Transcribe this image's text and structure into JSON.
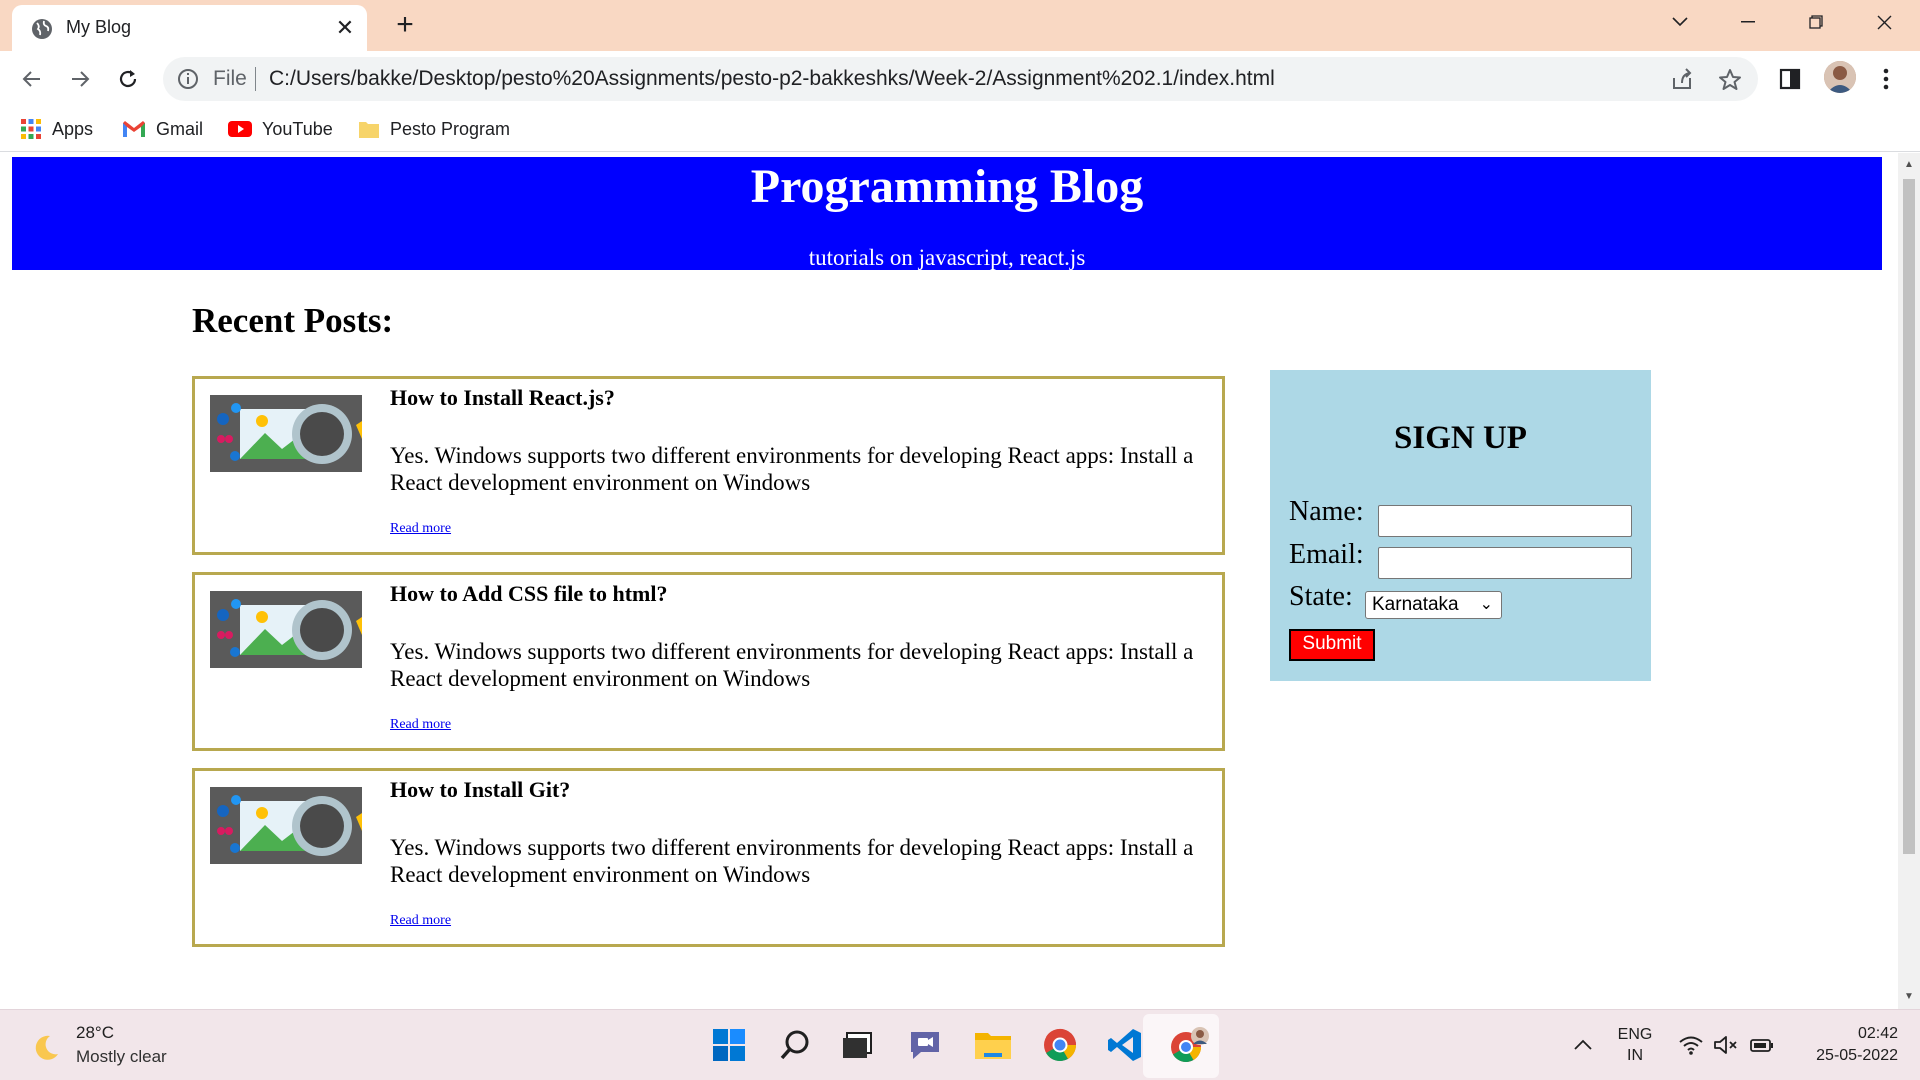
{
  "browser": {
    "tab_title": "My Blog",
    "omnibox_scheme": "File",
    "url": "C:/Users/bakke/Desktop/pesto%20Assignments/pesto-p2-bakkeshks/Week-2/Assignment%202.1/index.html",
    "bookmarks": [
      {
        "label": "Apps",
        "icon": "apps-grid-icon"
      },
      {
        "label": "Gmail",
        "icon": "gmail-icon"
      },
      {
        "label": "YouTube",
        "icon": "youtube-icon"
      },
      {
        "label": "Pesto Program",
        "icon": "folder-icon"
      }
    ]
  },
  "page": {
    "header_title": "Programming Blog",
    "header_subtitle": "tutorials on javascript, react.js",
    "section_title": "Recent Posts:",
    "posts": [
      {
        "title": "How to Install React.js?",
        "body": "Yes. Windows supports two different environments for developing React apps: Install a React development environment on Windows",
        "link": "Read more"
      },
      {
        "title": "How to Add CSS file to html?",
        "body": "Yes. Windows supports two different environments for developing React apps: Install a React development environment on Windows",
        "link": "Read more"
      },
      {
        "title": "How to Install Git?",
        "body": "Yes. Windows supports two different environments for developing React apps: Install a React development environment on Windows",
        "link": "Read more"
      }
    ],
    "signup": {
      "title": "SIGN UP",
      "name_label": "Name:",
      "email_label": "Email:",
      "state_label": "State:",
      "state_value": "Karnataka",
      "submit_label": "Submit"
    }
  },
  "taskbar": {
    "weather_temp": "28°C",
    "weather_desc": "Mostly clear",
    "lang_line1": "ENG",
    "lang_line2": "IN",
    "time": "02:42",
    "date": "25-05-2022"
  },
  "colors": {
    "header_bg": "#0000ff",
    "signup_bg": "#add8e6",
    "submit_bg": "#ff0000",
    "post_border": "#b8a84f"
  }
}
